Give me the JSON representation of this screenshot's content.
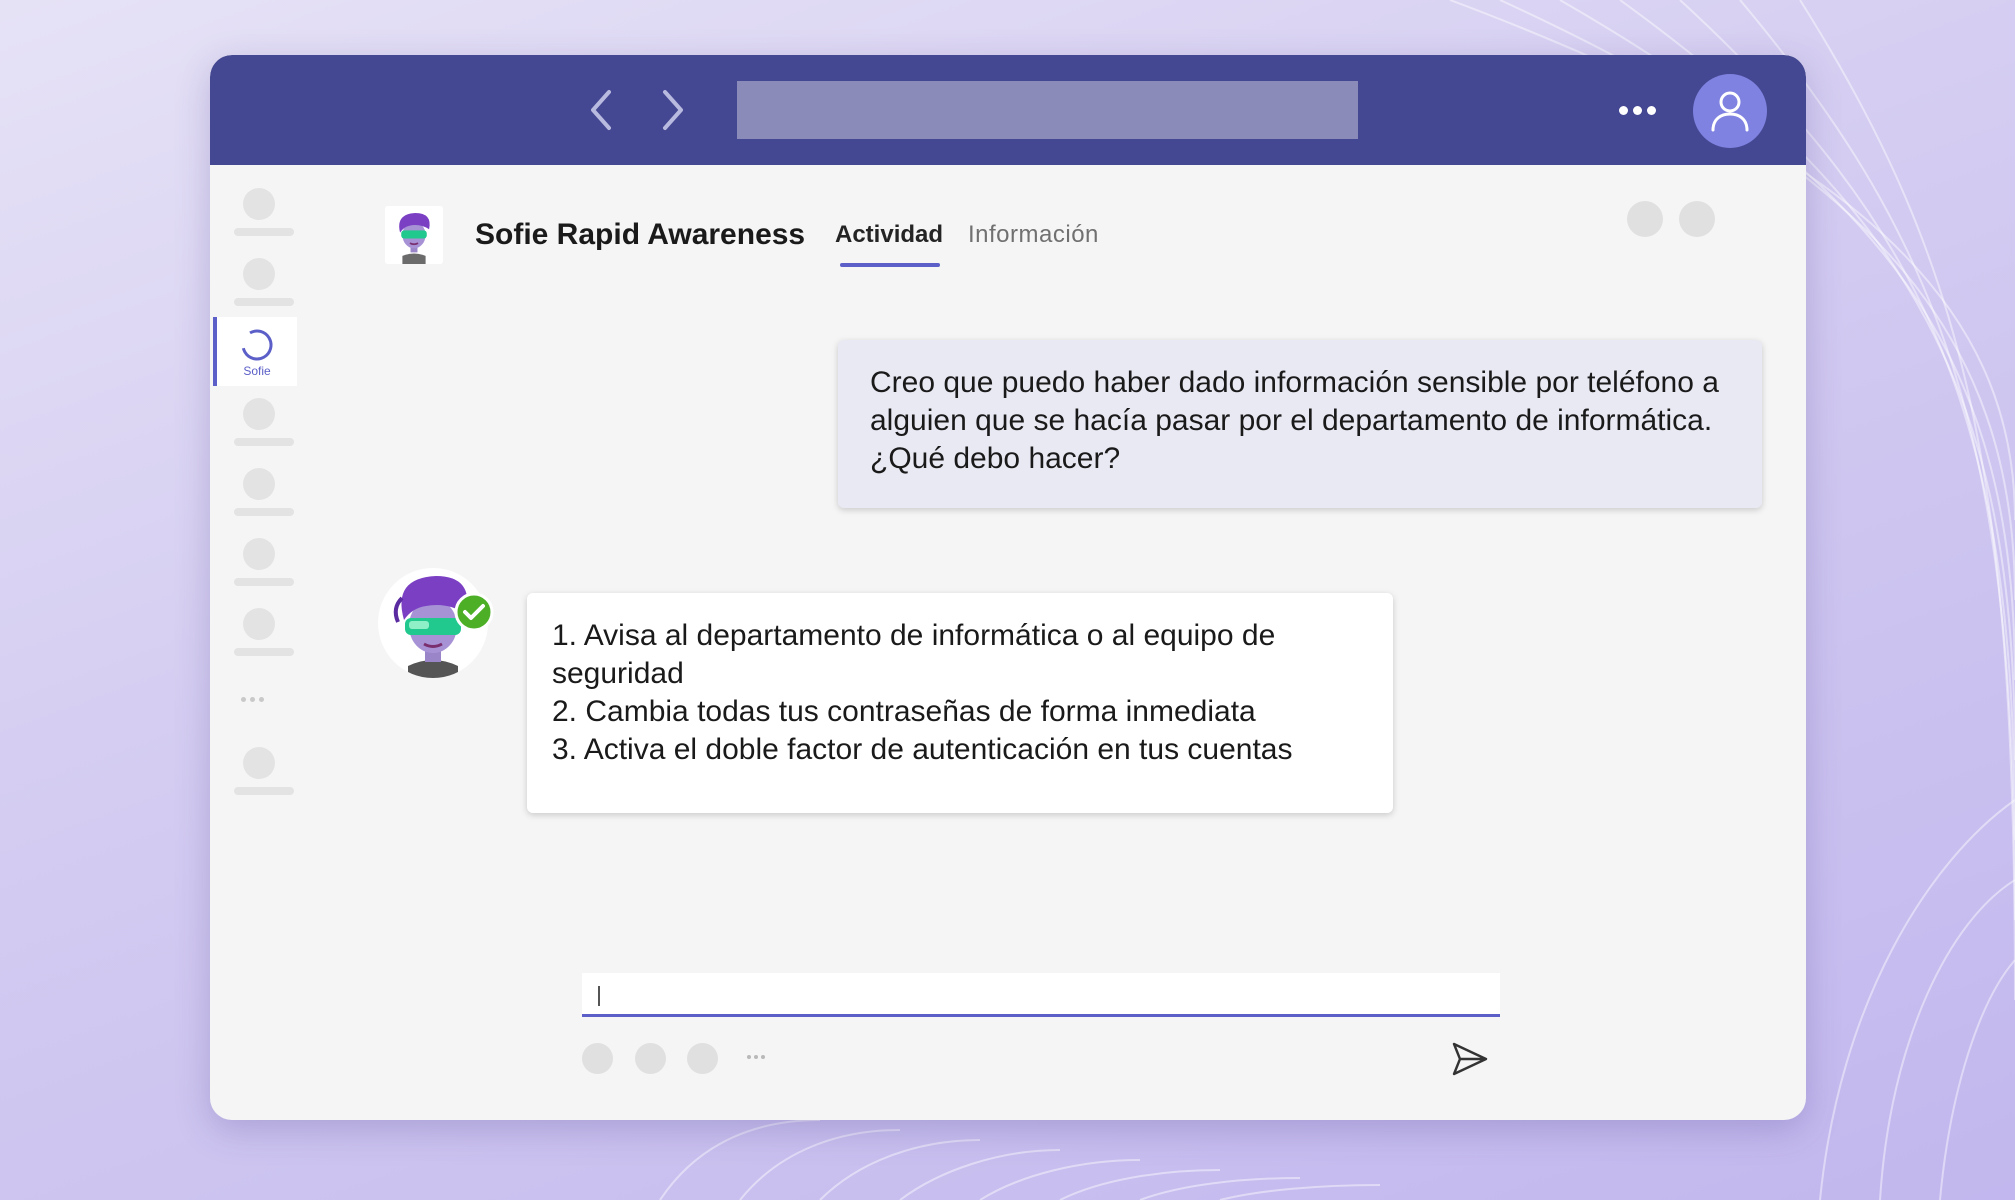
{
  "topbar": {
    "back_icon": "chevron-left-icon",
    "forward_icon": "chevron-right-icon",
    "search_value": "",
    "more_icon": "more-horizontal-icon",
    "profile_icon": "person-icon"
  },
  "sidebar": {
    "active_app": {
      "label": "Sofie",
      "icon": "sofie-ring-icon"
    }
  },
  "header": {
    "title": "Sofie Rapid Awareness",
    "tabs": [
      {
        "label": "Actividad",
        "active": true
      },
      {
        "label": "Información",
        "active": false
      }
    ]
  },
  "messages": {
    "user": "Creo que puedo haber dado información sensible por teléfono a alguien que se hacía pasar por el departamento de informática. ¿Qué debo hacer?",
    "bot_lines": [
      "1. Avisa al departamento de informática o al equipo de seguridad",
      "2. Cambia todas tus contraseñas de forma inmediata",
      "3. Activa el doble factor de autenticación en tus cuentas"
    ]
  },
  "compose": {
    "value": "",
    "send_icon": "send-icon"
  },
  "colors": {
    "brand": "#444791",
    "accent": "#5b5fc7",
    "status_ok": "#4caf25",
    "hair": "#7b3fc4",
    "goggles": "#22c98e"
  }
}
